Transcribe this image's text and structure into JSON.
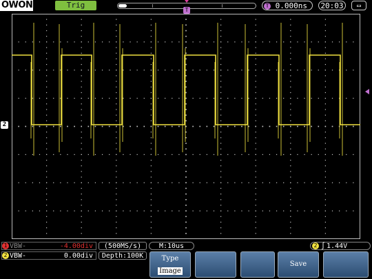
{
  "header": {
    "logo": "OWON",
    "trigger_status": "Trig",
    "trigger_position": "0.000ns",
    "trigger_position_badge": "T",
    "clock": "20:03"
  },
  "markers": {
    "trigger_marker": "T",
    "channel_marker": "2"
  },
  "channels": {
    "ch1": {
      "badge": "1",
      "label": "VBW-",
      "value": "-4.00div",
      "color": "#e03030"
    },
    "ch2": {
      "badge": "2",
      "label": "VBW-",
      "value": "0.00div",
      "color": "#f0e040"
    }
  },
  "acquisition": {
    "sample_rate": "(500MS/s)",
    "depth": "Depth:100K"
  },
  "timebase": "M:10us",
  "trigger_level": {
    "badge": "2",
    "edge": "rising-edge-icon",
    "value": "1.44V"
  },
  "softkeys": {
    "type_label": "Type",
    "type_value": "Image",
    "save_label": "Save"
  },
  "colors": {
    "trace": "#f0e040",
    "grid": "#c8c8c8",
    "trigger": "#c070d0"
  }
}
